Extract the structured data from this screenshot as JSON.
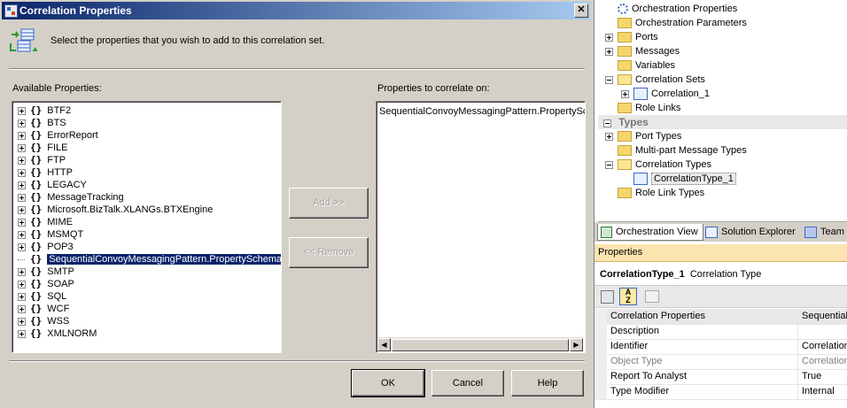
{
  "dialog": {
    "title": "Correlation Properties",
    "instruction": "Select the properties that you wish to add to this correlation set.",
    "available_label": "Available Properties:",
    "correlate_label": "Properties to correlate on:",
    "available_items": [
      {
        "label": "BTF2",
        "expandable": true
      },
      {
        "label": "BTS",
        "expandable": true
      },
      {
        "label": "ErrorReport",
        "expandable": true
      },
      {
        "label": "FILE",
        "expandable": true
      },
      {
        "label": "FTP",
        "expandable": true
      },
      {
        "label": "HTTP",
        "expandable": true
      },
      {
        "label": "LEGACY",
        "expandable": true
      },
      {
        "label": "MessageTracking",
        "expandable": true
      },
      {
        "label": "Microsoft.BizTalk.XLANGs.BTXEngine",
        "expandable": true
      },
      {
        "label": "MIME",
        "expandable": true
      },
      {
        "label": "MSMQT",
        "expandable": true
      },
      {
        "label": "POP3",
        "expandable": true
      },
      {
        "label": "SequentialConvoyMessagingPattern.PropertySchema",
        "expandable": false,
        "selected": true
      },
      {
        "label": "SMTP",
        "expandable": true
      },
      {
        "label": "SOAP",
        "expandable": true
      },
      {
        "label": "SQL",
        "expandable": true
      },
      {
        "label": "WCF",
        "expandable": true
      },
      {
        "label": "WSS",
        "expandable": true
      },
      {
        "label": "XMLNORM",
        "expandable": true
      }
    ],
    "correlate_items": [
      "SequentialConvoyMessagingPattern.PropertySc"
    ],
    "add_label": "Add >>",
    "remove_label": "<< Remove",
    "ok_label": "OK",
    "cancel_label": "Cancel",
    "help_label": "Help",
    "close_glyph": "✕"
  },
  "orchestration_tree": {
    "items": [
      {
        "label": "Orchestration Properties",
        "icon": "gear-icon",
        "indent": 1,
        "expander": "none"
      },
      {
        "label": "Orchestration Parameters",
        "icon": "folder-icon",
        "indent": 1,
        "expander": "none"
      },
      {
        "label": "Ports",
        "icon": "folder-icon",
        "indent": 1,
        "expander": "plus"
      },
      {
        "label": "Messages",
        "icon": "folder-icon",
        "indent": 1,
        "expander": "plus"
      },
      {
        "label": "Variables",
        "icon": "folder-icon",
        "indent": 1,
        "expander": "none"
      },
      {
        "label": "Correlation Sets",
        "icon": "folder-open-icon",
        "indent": 1,
        "expander": "minus"
      },
      {
        "label": "Correlation_1",
        "icon": "correlation-set-icon",
        "indent": 2,
        "expander": "plus"
      },
      {
        "label": "Role Links",
        "icon": "folder-icon",
        "indent": 1,
        "expander": "none"
      }
    ],
    "types_header": "Types",
    "types_items": [
      {
        "label": "Port Types",
        "icon": "folder-icon",
        "indent": 1,
        "expander": "plus"
      },
      {
        "label": "Multi-part Message Types",
        "icon": "folder-icon",
        "indent": 1,
        "expander": "none"
      },
      {
        "label": "Correlation Types",
        "icon": "folder-open-icon",
        "indent": 1,
        "expander": "minus"
      },
      {
        "label": "CorrelationType_1",
        "icon": "correlation-type-icon",
        "indent": 2,
        "expander": "none",
        "selected": true
      },
      {
        "label": "Role Link Types",
        "icon": "folder-icon",
        "indent": 1,
        "expander": "none"
      }
    ]
  },
  "panel_tabs": [
    {
      "label": "Orchestration View",
      "active": true
    },
    {
      "label": "Solution Explorer",
      "active": false
    },
    {
      "label": "Team",
      "active": false
    }
  ],
  "properties": {
    "header": "Properties",
    "object_name": "CorrelationType_1",
    "object_type": "Correlation Type",
    "rows": [
      {
        "key": "Correlation Properties",
        "value": "Sequential",
        "highlight": true
      },
      {
        "key": "Description",
        "value": ""
      },
      {
        "key": "Identifier",
        "value": "Correlation"
      },
      {
        "key": "Object Type",
        "value": "Correlation",
        "greyed": true
      },
      {
        "key": "Report To Analyst",
        "value": "True"
      },
      {
        "key": "Type Modifier",
        "value": "Internal"
      }
    ]
  }
}
